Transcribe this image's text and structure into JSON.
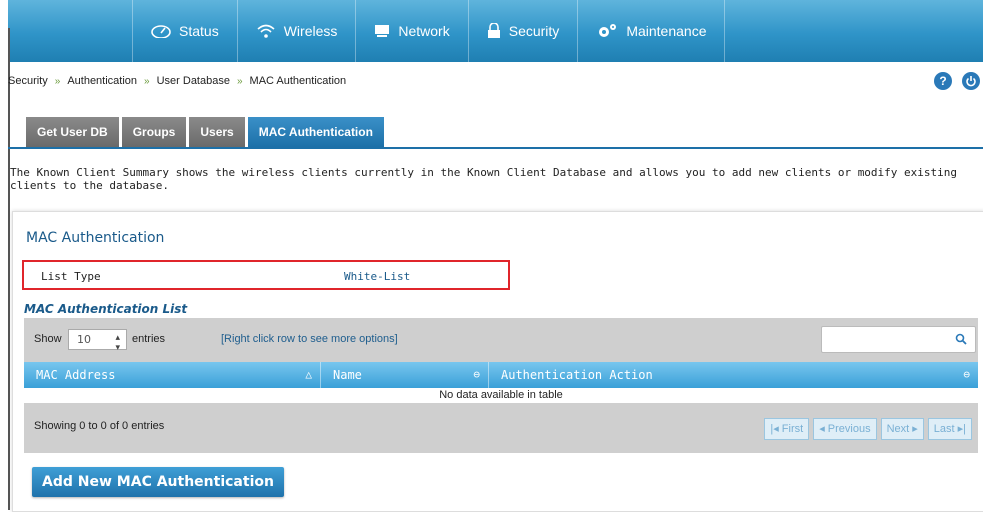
{
  "nav": {
    "items": [
      {
        "label": "Status",
        "icon": "dashboard-icon"
      },
      {
        "label": "Wireless",
        "icon": "wifi-icon"
      },
      {
        "label": "Network",
        "icon": "monitor-icon"
      },
      {
        "label": "Security",
        "icon": "lock-icon"
      },
      {
        "label": "Maintenance",
        "icon": "gears-icon"
      }
    ]
  },
  "breadcrumb": [
    "Security",
    "Authentication",
    "User Database",
    "MAC Authentication"
  ],
  "breadcrumb_sep": "»",
  "help_label": "?",
  "tabs": [
    {
      "label": "Get User DB",
      "active": false
    },
    {
      "label": "Groups",
      "active": false
    },
    {
      "label": "Users",
      "active": false
    },
    {
      "label": "MAC Authentication",
      "active": true
    }
  ],
  "description": "The Known Client Summary shows the wireless clients currently in the Known Client Database and allows you to add new clients or modify existing clients to the database.",
  "section": {
    "title": "MAC Authentication",
    "list_type_label": "List Type",
    "list_type_value": "White-List",
    "list_title": "MAC Authentication List"
  },
  "table": {
    "show_label": "Show",
    "entries_value": "10",
    "entries_label": "entries",
    "hint": "[Right click row to see more options]",
    "columns": [
      "MAC Address",
      "Name",
      "Authentication Action"
    ],
    "empty_text": "No data available in table",
    "info": "Showing 0 to 0 of 0 entries",
    "pager": [
      "First",
      "Previous",
      "Next",
      "Last"
    ]
  },
  "add_button": "Add New MAC Authentication",
  "colors": {
    "accent": "#1f72ab",
    "highlight_border": "#e0252b"
  }
}
